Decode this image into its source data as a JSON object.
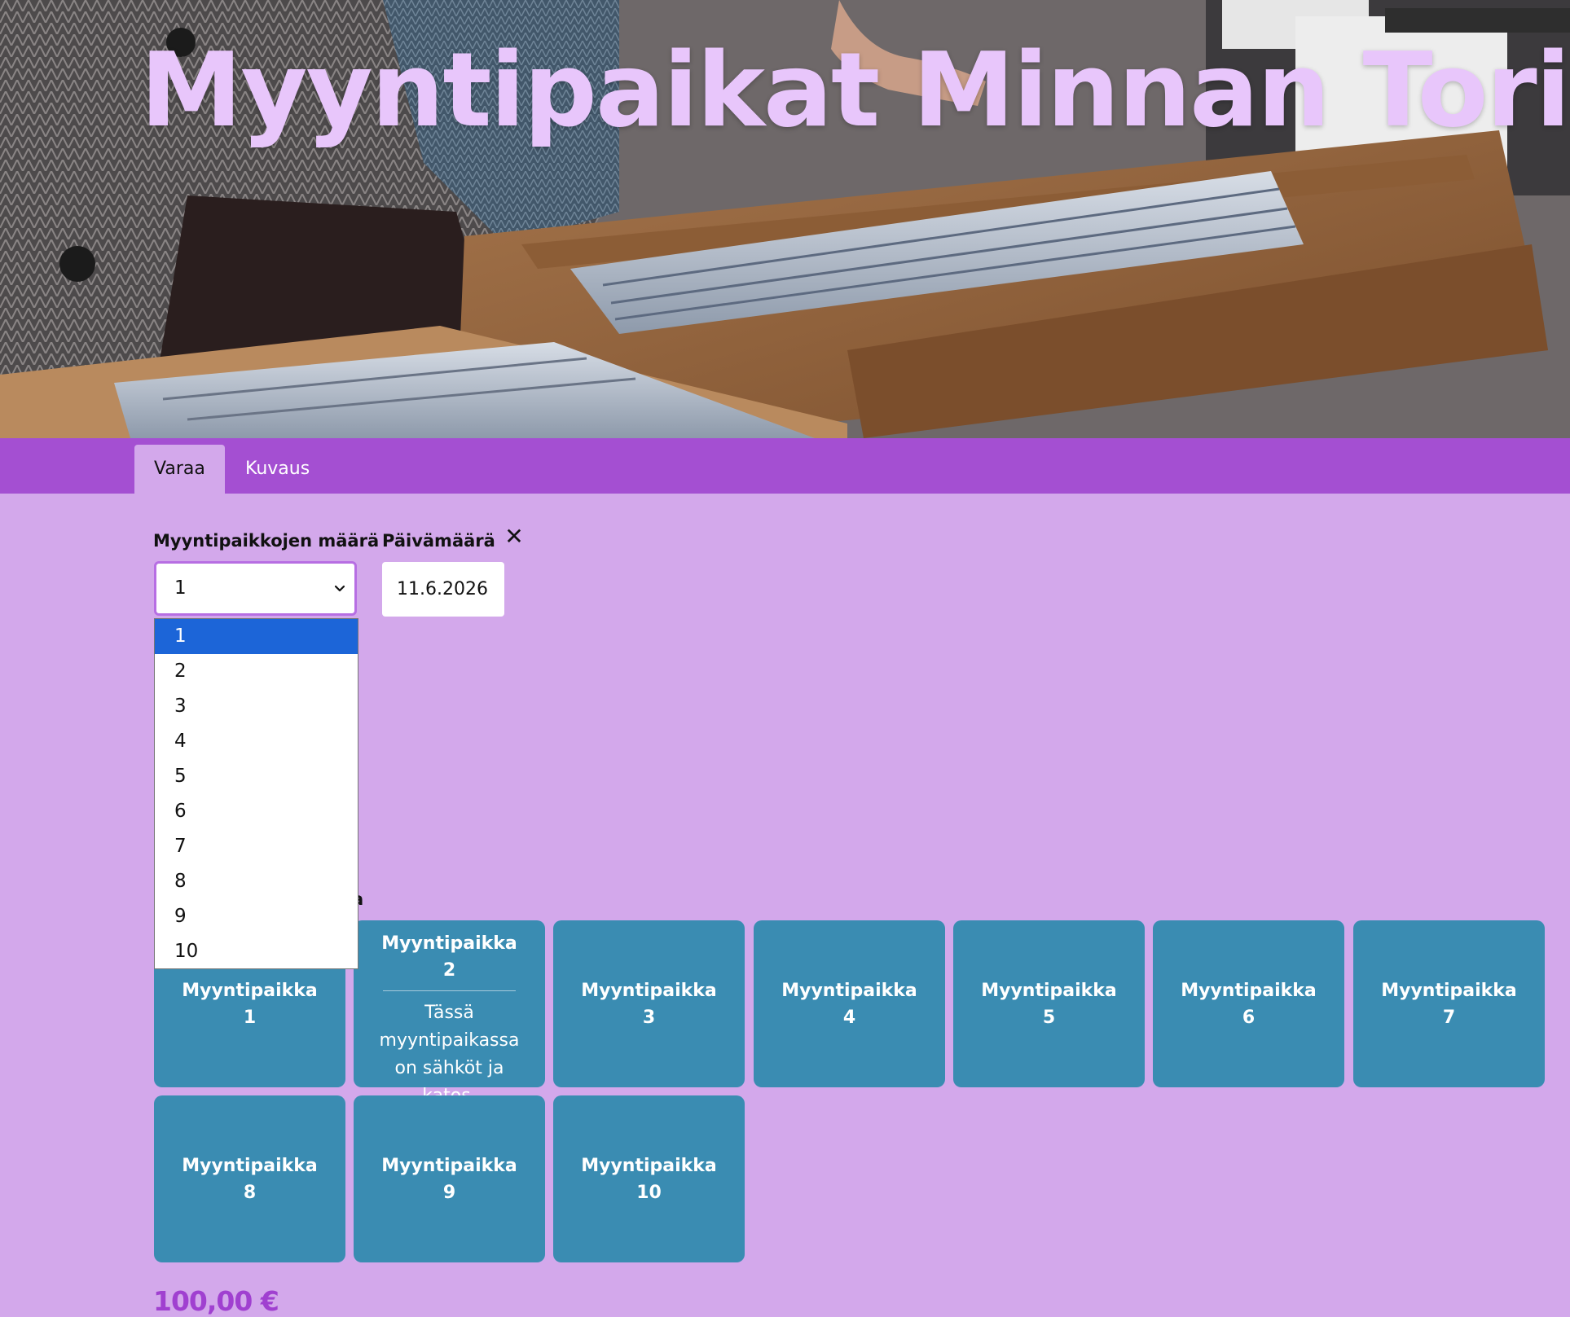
{
  "hero": {
    "title": "Myyntipaikat Minnan Torilla"
  },
  "tabs": [
    {
      "label": "Varaa",
      "active": true
    },
    {
      "label": "Kuvaus",
      "active": false
    }
  ],
  "form": {
    "count_label": "Myyntipaikkojen määrä",
    "count_value": "1",
    "date_label": "Päivämäärä",
    "date_value": "11.6.2026",
    "clear_icon": "close-icon",
    "dropdown_options": [
      "1",
      "2",
      "3",
      "4",
      "5",
      "6",
      "7",
      "8",
      "9",
      "10"
    ],
    "dropdown_selected": "1"
  },
  "grid": {
    "heading_visible_fragment": "a",
    "stalls": [
      {
        "name": "Myyntipaikka 1"
      },
      {
        "name": "Myyntipaikka 2",
        "description": "Tässä myyntipaikassa on sähköt ja katos."
      },
      {
        "name": "Myyntipaikka 3"
      },
      {
        "name": "Myyntipaikka 4"
      },
      {
        "name": "Myyntipaikka 5"
      },
      {
        "name": "Myyntipaikka 6"
      },
      {
        "name": "Myyntipaikka 7"
      },
      {
        "name": "Myyntipaikka 8"
      },
      {
        "name": "Myyntipaikka 9"
      },
      {
        "name": "Myyntipaikka 10"
      }
    ]
  },
  "price": "100,00 €",
  "colors": {
    "page_background": "#d3a8eb",
    "tab_bar": "#a44fd2",
    "stall_tile": "#3a8cb2",
    "title": "#e8c6fb",
    "price": "#a040d0",
    "option_selected": "#1c65d8"
  }
}
